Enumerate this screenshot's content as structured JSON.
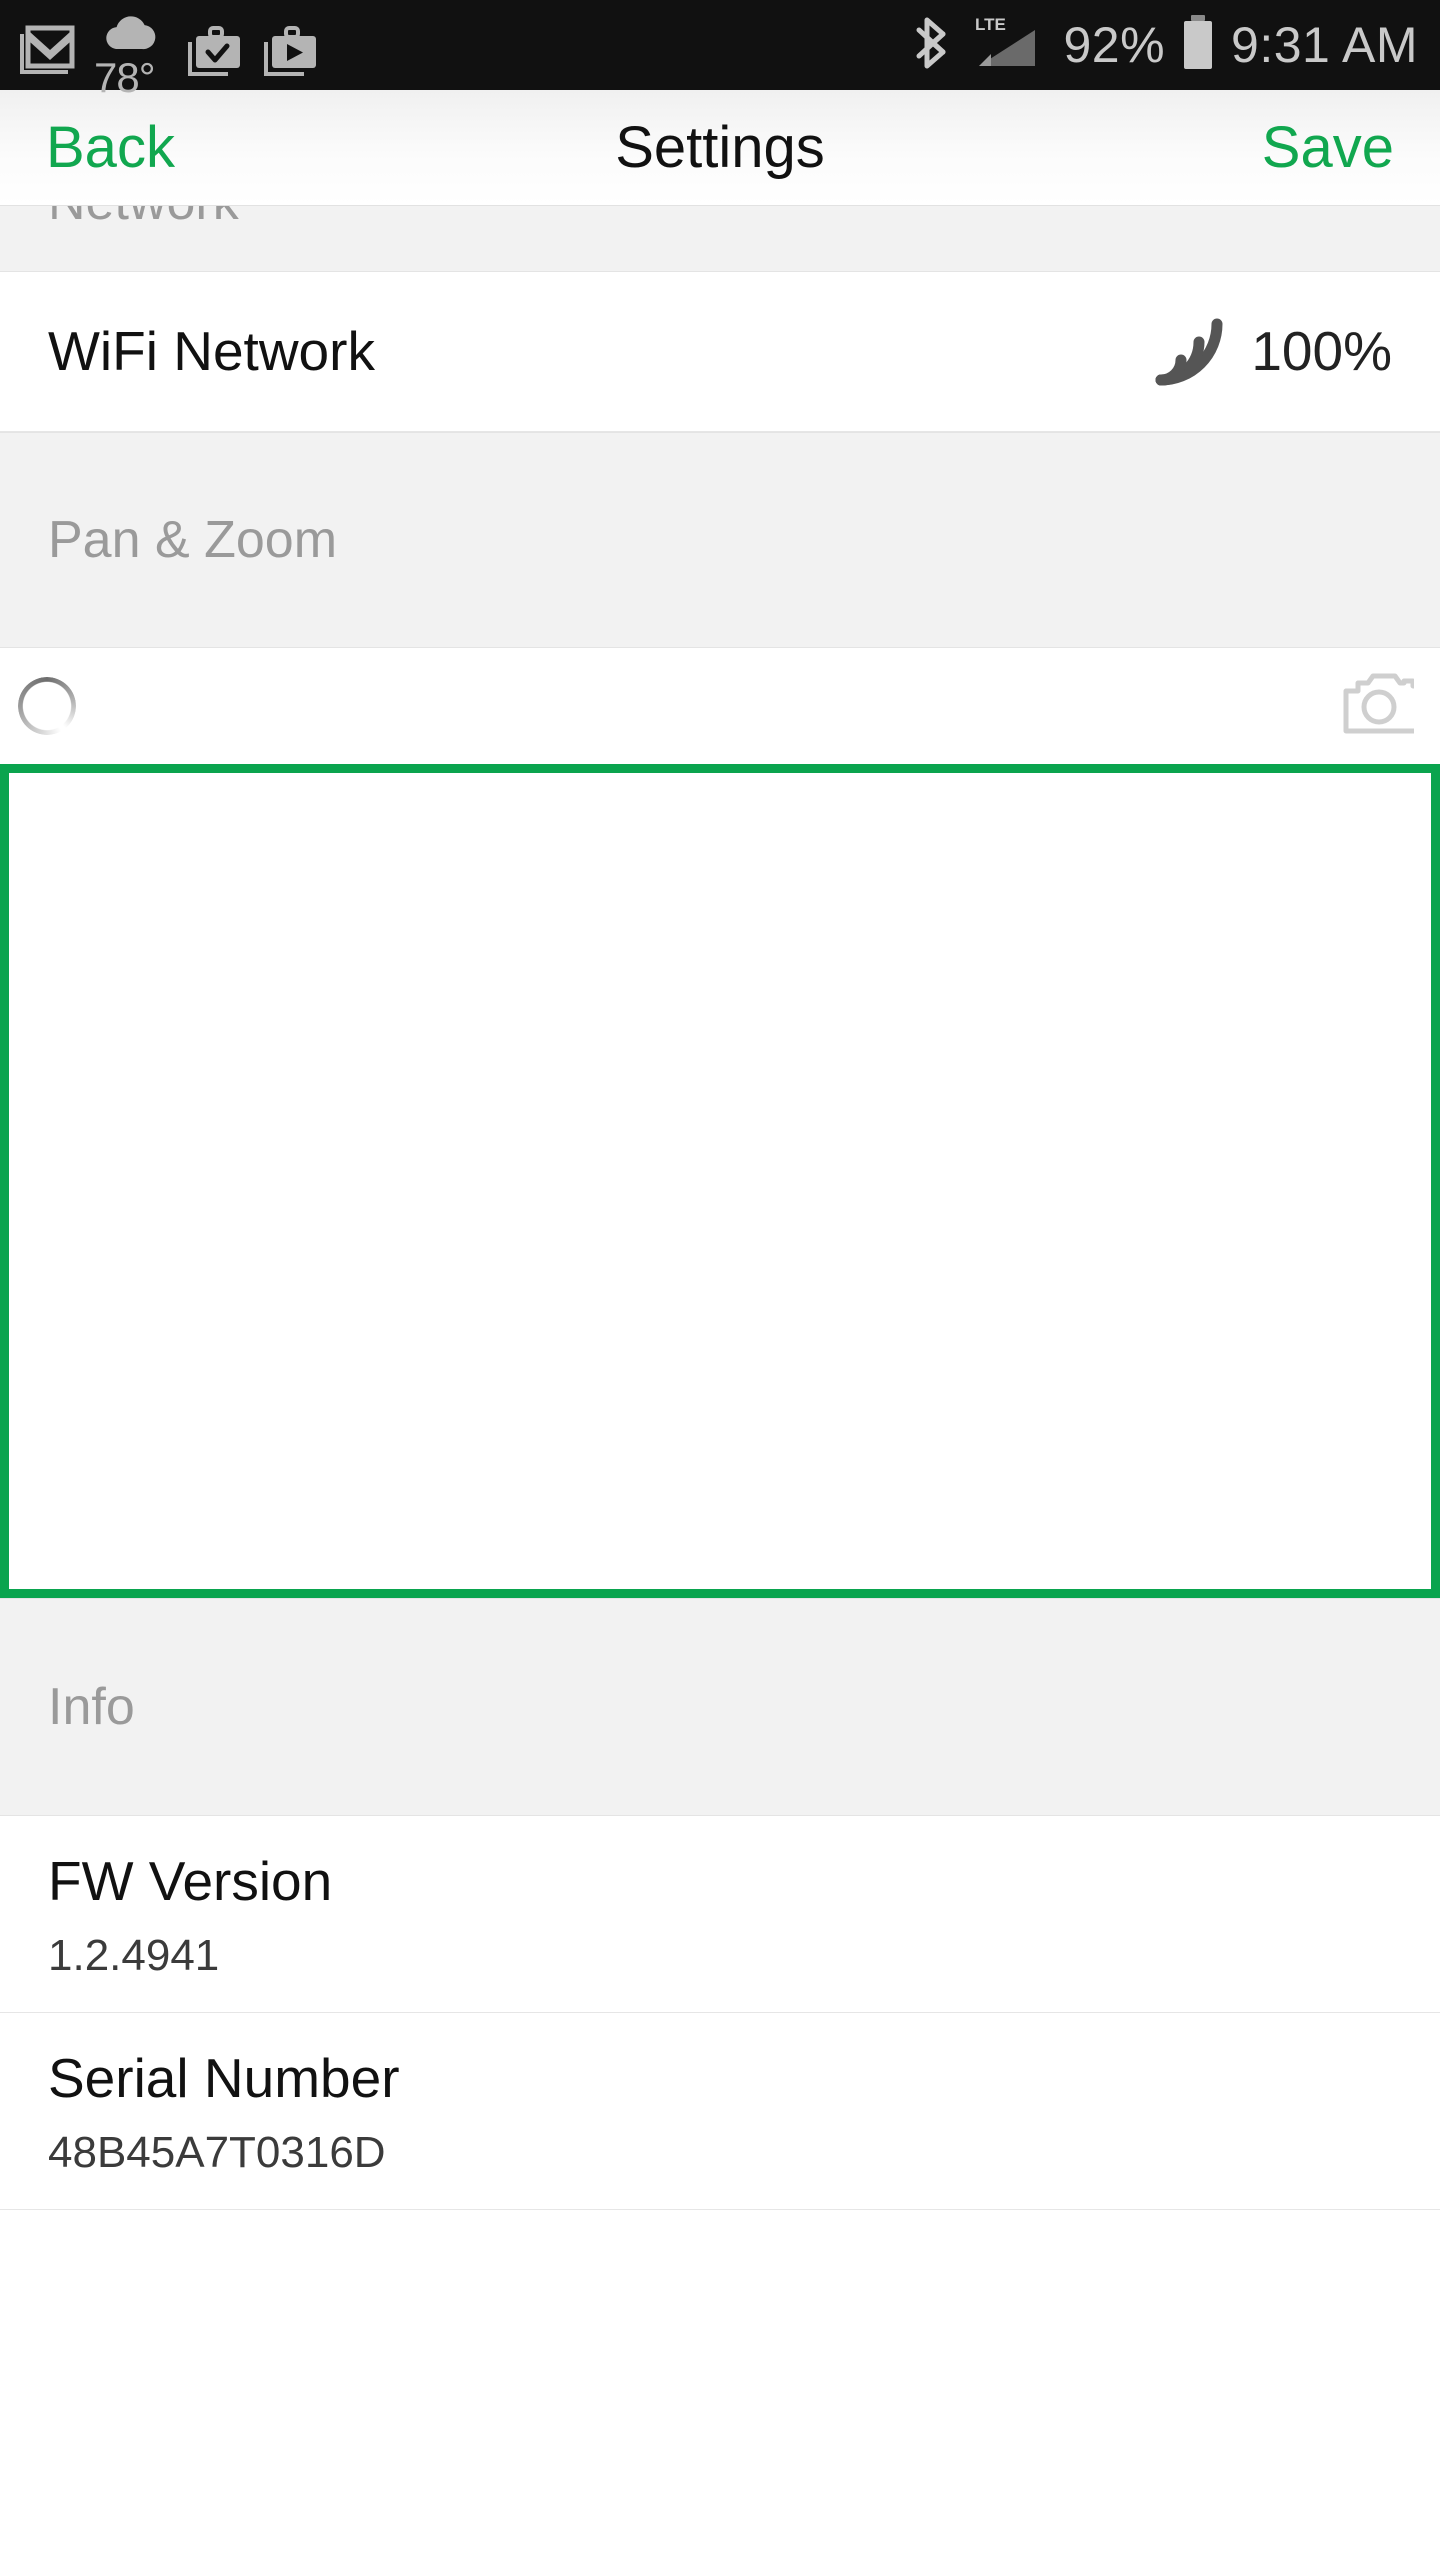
{
  "statusbar": {
    "left_icons": [
      {
        "name": "gmail-icon",
        "label": "Gmail"
      },
      {
        "name": "weather-icon",
        "label": "Weather"
      },
      {
        "name": "tasks-briefcase-icon",
        "label": "Tasks"
      },
      {
        "name": "play-briefcase-icon",
        "label": "Play"
      }
    ],
    "weather_temp": "78°",
    "bluetooth_label": "Bluetooth",
    "network_type": "LTE",
    "battery_percent": "92%",
    "time": "9:31 AM"
  },
  "navbar": {
    "back_label": "Back",
    "title": "Settings",
    "save_label": "Save",
    "accent_color": "#11a74f"
  },
  "sections": {
    "network": {
      "header": "Network",
      "wifi_label": "WiFi Network",
      "wifi_signal_icon": "wifi-signal-icon",
      "wifi_value": "100%"
    },
    "pan_zoom": {
      "header": "Pan & Zoom",
      "spinner_icon": "loading-spinner-icon",
      "camera_icon": "camera-icon",
      "viewport_border_color": "#0aa44e"
    },
    "info": {
      "header": "Info",
      "items": [
        {
          "title": "FW Version",
          "value": "1.2.4941"
        },
        {
          "title": "Serial Number",
          "value": "48B45A7T0316D"
        }
      ]
    }
  }
}
